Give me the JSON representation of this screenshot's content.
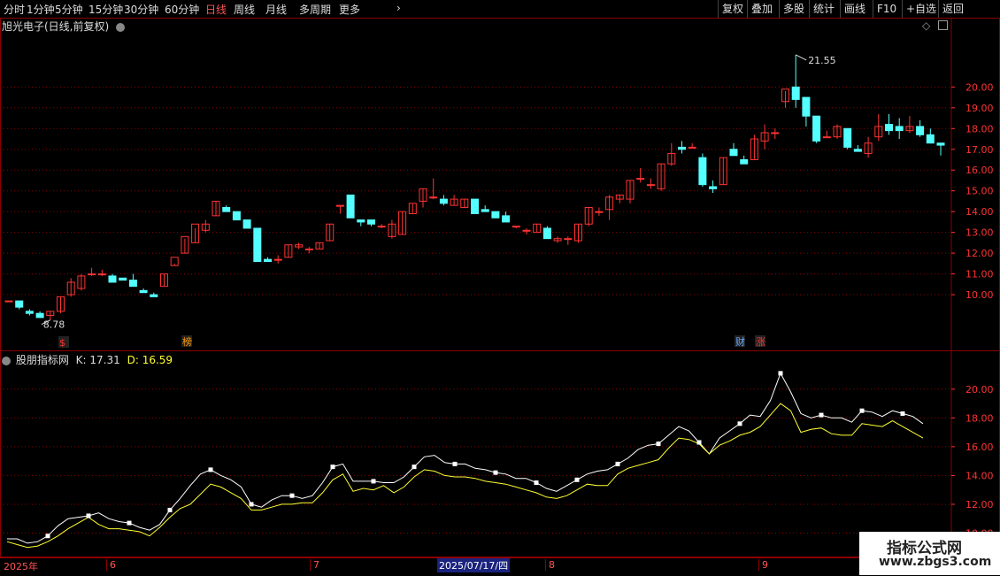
{
  "toolbar": {
    "left_items": [
      "分时",
      "1分钟",
      "5分钟",
      "15分钟",
      "30分钟",
      "60分钟",
      "日线",
      "周线",
      "月线",
      "多周期",
      "更多"
    ],
    "active": "日线",
    "right_items": [
      "复权",
      "叠加",
      "多股",
      "统计",
      "画线",
      "F10",
      "+自选",
      "返回"
    ]
  },
  "main_panel": {
    "title": "旭光电子(日线,前复权)",
    "high_label": "21.55",
    "low_label": "8.78",
    "markers": [
      {
        "text": "$",
        "color": "#ff3333"
      },
      {
        "text": "榜",
        "color": "#ff9900"
      },
      {
        "text": "财",
        "color": "#66aaff"
      },
      {
        "text": "涨",
        "color": "#ff3333"
      }
    ]
  },
  "indicator_panel": {
    "title": "股朋指标网",
    "k_label": "K: 17.31",
    "d_label": "D: 16.59"
  },
  "time_axis": {
    "labels": [
      "2025年",
      "6",
      "7",
      "8",
      "9"
    ],
    "cursor_date": "2025/07/17/四"
  },
  "watermark": {
    "line1": "指标公式网",
    "line2": "www.zbgs3.com"
  },
  "colors": {
    "up": "#ff3333",
    "down": "#54ffff",
    "grid": "#8b0000",
    "k_line": "#ffffff",
    "d_line": "#ffff33"
  },
  "chart_data": [
    {
      "type": "candlestick",
      "y_ticks": [
        10.0,
        11.0,
        12.0,
        13.0,
        14.0,
        15.0,
        16.0,
        17.0,
        18.0,
        19.0,
        20.0
      ],
      "ylim": [
        8.0,
        22.4
      ],
      "high": 21.55,
      "low": 8.78,
      "ohlc": [
        [
          9.7,
          9.7,
          9.7,
          9.7
        ],
        [
          9.7,
          9.7,
          9.3,
          9.4
        ],
        [
          9.2,
          9.3,
          9.0,
          9.1
        ],
        [
          9.1,
          9.2,
          8.9,
          8.9
        ],
        [
          9.0,
          9.2,
          8.78,
          9.2
        ],
        [
          9.2,
          9.9,
          9.1,
          9.9
        ],
        [
          10.0,
          10.8,
          9.9,
          10.6
        ],
        [
          10.3,
          11.0,
          10.2,
          10.9
        ],
        [
          11.0,
          11.3,
          10.9,
          11.0
        ],
        [
          11.0,
          11.2,
          10.9,
          11.0
        ],
        [
          10.9,
          11.0,
          10.6,
          10.6
        ],
        [
          10.8,
          10.8,
          10.7,
          10.7
        ],
        [
          10.7,
          11.0,
          10.5,
          10.4
        ],
        [
          10.2,
          10.3,
          10.1,
          10.1
        ],
        [
          10.0,
          10.1,
          9.9,
          9.9
        ],
        [
          10.4,
          11.0,
          10.4,
          11.0
        ],
        [
          11.4,
          11.5,
          11.4,
          11.8
        ],
        [
          12.0,
          12.7,
          12.0,
          12.8
        ],
        [
          12.5,
          13.2,
          12.5,
          13.4
        ],
        [
          13.1,
          13.6,
          13.0,
          13.4
        ],
        [
          13.8,
          14.5,
          13.8,
          14.5
        ],
        [
          14.2,
          14.3,
          14.0,
          14.0
        ],
        [
          14.0,
          14.0,
          13.6,
          13.6
        ],
        [
          13.6,
          13.6,
          13.3,
          13.2
        ],
        [
          13.2,
          13.2,
          11.6,
          11.6
        ],
        [
          11.7,
          11.8,
          11.6,
          11.6
        ],
        [
          11.7,
          11.9,
          11.5,
          11.7
        ],
        [
          11.8,
          12.4,
          11.8,
          12.4
        ],
        [
          12.3,
          12.5,
          12.2,
          12.4
        ],
        [
          12.2,
          12.3,
          12.0,
          12.2
        ],
        [
          12.2,
          12.5,
          12.2,
          12.5
        ],
        [
          12.6,
          13.4,
          12.6,
          13.4
        ],
        [
          14.3,
          14.3,
          13.9,
          14.3
        ],
        [
          14.8,
          14.8,
          13.7,
          13.7
        ],
        [
          13.6,
          13.6,
          13.3,
          13.5
        ],
        [
          13.6,
          13.6,
          13.3,
          13.4
        ],
        [
          13.3,
          13.4,
          13.2,
          13.3
        ],
        [
          12.8,
          13.6,
          12.7,
          13.4
        ],
        [
          12.9,
          14.0,
          12.9,
          14.0
        ],
        [
          13.9,
          14.4,
          13.9,
          14.4
        ],
        [
          14.5,
          15.1,
          14.2,
          15.1
        ],
        [
          14.7,
          15.6,
          14.6,
          14.7
        ],
        [
          14.6,
          14.8,
          14.3,
          14.4
        ],
        [
          14.3,
          14.8,
          14.3,
          14.6
        ],
        [
          14.2,
          14.6,
          14.2,
          14.6
        ],
        [
          14.6,
          14.6,
          13.9,
          13.9
        ],
        [
          14.1,
          14.3,
          14.1,
          14.0
        ],
        [
          14.0,
          14.0,
          13.7,
          13.7
        ],
        [
          13.8,
          14.0,
          13.5,
          13.5
        ],
        [
          13.3,
          13.3,
          13.2,
          13.3
        ],
        [
          13.1,
          13.2,
          12.9,
          13.1
        ],
        [
          13.0,
          13.4,
          13.0,
          13.4
        ],
        [
          13.2,
          13.3,
          12.7,
          12.7
        ],
        [
          12.6,
          12.8,
          12.5,
          12.7
        ],
        [
          12.7,
          12.8,
          12.4,
          12.7
        ],
        [
          12.6,
          13.4,
          12.5,
          13.4
        ],
        [
          13.4,
          14.2,
          13.3,
          14.2
        ],
        [
          14.0,
          14.2,
          13.8,
          14.0
        ],
        [
          14.1,
          14.8,
          13.6,
          14.7
        ],
        [
          14.6,
          14.8,
          14.4,
          14.8
        ],
        [
          14.6,
          15.5,
          14.4,
          15.5
        ],
        [
          15.6,
          16.1,
          15.4,
          15.6
        ],
        [
          15.3,
          15.6,
          15.1,
          15.3
        ],
        [
          15.1,
          16.3,
          15.0,
          16.3
        ],
        [
          16.3,
          17.3,
          16.2,
          16.8
        ],
        [
          17.1,
          17.4,
          16.8,
          17.0
        ],
        [
          17.1,
          17.3,
          17.1,
          17.1
        ],
        [
          16.6,
          16.8,
          15.2,
          15.3
        ],
        [
          15.2,
          15.5,
          14.9,
          15.1
        ],
        [
          15.3,
          16.6,
          15.3,
          16.6
        ],
        [
          17.0,
          17.3,
          16.7,
          16.7
        ],
        [
          16.5,
          16.7,
          16.3,
          16.3
        ],
        [
          16.5,
          17.7,
          16.5,
          17.5
        ],
        [
          17.4,
          18.2,
          17.0,
          17.8
        ],
        [
          17.8,
          18.0,
          17.5,
          17.8
        ],
        [
          19.3,
          19.8,
          19.0,
          19.9
        ],
        [
          20.0,
          21.55,
          19.0,
          19.4
        ],
        [
          19.5,
          19.5,
          18.1,
          18.6
        ],
        [
          18.6,
          18.6,
          17.3,
          17.4
        ],
        [
          17.6,
          17.9,
          17.6,
          17.6
        ],
        [
          17.6,
          18.2,
          17.5,
          18.1
        ],
        [
          18.0,
          18.0,
          17.0,
          17.1
        ],
        [
          17.0,
          17.2,
          16.9,
          16.9
        ],
        [
          16.8,
          17.6,
          16.6,
          17.3
        ],
        [
          17.6,
          18.7,
          17.4,
          18.1
        ],
        [
          18.2,
          18.7,
          17.7,
          17.9
        ],
        [
          18.1,
          18.5,
          17.5,
          17.9
        ],
        [
          17.9,
          18.6,
          17.8,
          18.1
        ],
        [
          18.1,
          18.4,
          17.6,
          17.7
        ],
        [
          17.7,
          18.0,
          17.3,
          17.3
        ],
        [
          17.3,
          17.3,
          16.7,
          17.2
        ]
      ]
    },
    {
      "type": "line",
      "y_ticks": [
        10.0,
        12.0,
        14.0,
        16.0,
        18.0,
        20.0
      ],
      "ylim": [
        8.8,
        22.2
      ],
      "series": [
        {
          "name": "K",
          "values": [
            9.6,
            9.6,
            9.3,
            9.4,
            9.8,
            10.5,
            11.0,
            11.1,
            11.2,
            11.4,
            11.0,
            10.8,
            10.7,
            10.4,
            10.2,
            10.6,
            11.6,
            12.4,
            13.3,
            14.1,
            14.4,
            14.0,
            13.7,
            13.2,
            12.0,
            11.8,
            12.3,
            12.6,
            12.6,
            12.4,
            12.6,
            13.5,
            14.6,
            14.8,
            13.6,
            13.6,
            13.6,
            13.5,
            13.5,
            13.9,
            14.6,
            15.3,
            15.4,
            14.9,
            14.8,
            14.8,
            14.5,
            14.4,
            14.2,
            14.1,
            13.8,
            13.8,
            13.5,
            13.1,
            12.9,
            13.3,
            13.7,
            14.1,
            14.3,
            14.4,
            14.8,
            15.2,
            15.8,
            16.1,
            16.2,
            16.8,
            17.4,
            17.1,
            16.3,
            15.5,
            16.6,
            17.1,
            17.6,
            18.2,
            18.1,
            19.2,
            21.1,
            19.8,
            18.3,
            18.0,
            18.2,
            18.0,
            18.0,
            17.7,
            18.5,
            18.4,
            18.1,
            18.5,
            18.3,
            18.1,
            17.6
          ]
        },
        {
          "name": "D",
          "values": [
            9.4,
            9.2,
            9.0,
            9.1,
            9.4,
            9.8,
            10.3,
            10.7,
            11.1,
            10.6,
            10.3,
            10.3,
            10.2,
            10.1,
            9.8,
            10.4,
            11.1,
            11.7,
            12.0,
            12.7,
            13.4,
            13.2,
            12.8,
            12.4,
            11.6,
            11.6,
            11.8,
            12.0,
            12.0,
            12.1,
            12.1,
            12.8,
            13.7,
            14.1,
            12.9,
            13.1,
            13.0,
            13.3,
            12.8,
            13.2,
            13.9,
            14.4,
            14.3,
            14.0,
            13.9,
            13.9,
            13.8,
            13.6,
            13.5,
            13.4,
            13.2,
            13.0,
            12.8,
            12.5,
            12.4,
            12.6,
            13.0,
            13.4,
            13.3,
            13.3,
            14.1,
            14.5,
            14.7,
            14.9,
            15.1,
            15.9,
            16.6,
            16.5,
            16.2,
            15.5,
            16.1,
            16.4,
            16.8,
            17.0,
            17.4,
            18.2,
            19.0,
            18.5,
            17.0,
            17.2,
            17.3,
            16.9,
            16.8,
            16.8,
            17.6,
            17.5,
            17.4,
            17.8,
            17.4,
            17.0,
            16.6
          ]
        }
      ]
    }
  ]
}
